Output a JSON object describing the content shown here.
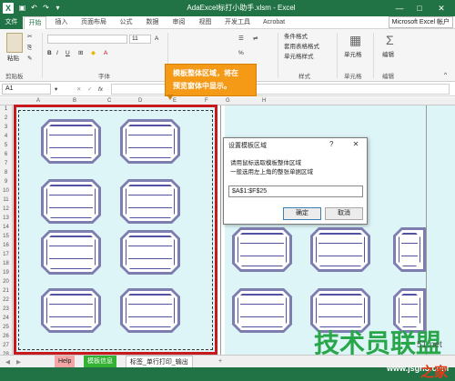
{
  "window": {
    "title": "AdaExcel标打小助手.xlsm - Excel",
    "app_icon": "X",
    "minimize": "—",
    "restore": "□",
    "close": "✕"
  },
  "ribbon_tabs": [
    "文件",
    "开始",
    "插入",
    "页面布局",
    "公式",
    "数据",
    "审阅",
    "视图",
    "开发工具",
    "Acrobat"
  ],
  "account_label": "Microsoft Excel 帐户",
  "ribbon": {
    "paste_label": "粘贴",
    "groups": {
      "clipboard": "剪贴板",
      "font": "字体",
      "styles": "样式",
      "cells": "单元格",
      "editing": "编辑"
    },
    "font_size": "11",
    "styles_items": [
      "条件格式",
      "套用表格格式",
      "单元格样式"
    ],
    "cells_label": "单元格",
    "editing_label": "编辑"
  },
  "formula_bar": {
    "name_box": "A1",
    "fx": "fx"
  },
  "grid": {
    "col_letters": [
      "A",
      "B",
      "C",
      "D",
      "E",
      "F",
      "G",
      "H"
    ],
    "row_numbers": [
      "1",
      "2",
      "3",
      "4",
      "5",
      "6",
      "7",
      "8",
      "9",
      "10",
      "11",
      "12",
      "13",
      "14",
      "15",
      "16",
      "17",
      "18",
      "19",
      "20",
      "21",
      "22",
      "23",
      "24",
      "25",
      "26",
      "27",
      "28"
    ]
  },
  "callout": {
    "line1": "模板整体区域，将在",
    "line2": "预览窗体中显示。"
  },
  "dialog": {
    "title": "设置模板区域",
    "help": "?",
    "close": "✕",
    "desc_line1": "请用鼠标选取模板整体区域",
    "desc_line2": "一般选用左上角的整张单据区域",
    "range_value": "$A$1:$F$25",
    "ok_label": "确定",
    "cancel_label": "取消"
  },
  "sheet_tabs": [
    {
      "label": "Help",
      "color": "#f4a6a6"
    },
    {
      "label": "模板信息",
      "color": "#33b233"
    },
    {
      "label": "标签_单行打印_输出",
      "color": "#ffffff"
    }
  ],
  "add_sheet": "+",
  "watermark": {
    "brand": "技术员联盟",
    "number": "51.net",
    "url": "www.jsgho.com",
    "com": "之家"
  },
  "colors": {
    "excel_green": "#217346",
    "highlight_red": "#c8191d",
    "callout_orange": "#f49a17",
    "label_border": "#7d7db0",
    "template_bg": "#ddf5f7"
  }
}
